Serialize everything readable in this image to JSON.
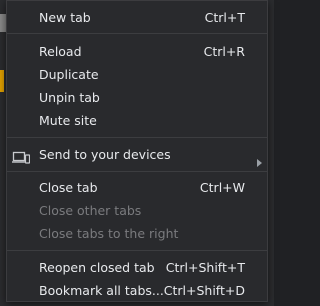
{
  "menu": {
    "items": {
      "new_tab": {
        "label": "New tab",
        "shortcut": "Ctrl+T"
      },
      "reload": {
        "label": "Reload",
        "shortcut": "Ctrl+R"
      },
      "duplicate": {
        "label": "Duplicate"
      },
      "unpin_tab": {
        "label": "Unpin tab"
      },
      "mute_site": {
        "label": "Mute site"
      },
      "send_to_devices": {
        "label": "Send to your devices",
        "icon": "devices-icon",
        "submenu_icon": "chevron-right-icon"
      },
      "close_tab": {
        "label": "Close tab",
        "shortcut": "Ctrl+W"
      },
      "close_other_tabs": {
        "label": "Close other tabs",
        "disabled": true
      },
      "close_tabs_right": {
        "label": "Close tabs to the right",
        "disabled": true
      },
      "reopen_closed_tab": {
        "label": "Reopen closed tab",
        "shortcut": "Ctrl+Shift+T"
      },
      "bookmark_all_tabs": {
        "label": "Bookmark all tabs...",
        "shortcut": "Ctrl+Shift+D"
      }
    }
  },
  "colors": {
    "menu_background": "#292a2d",
    "text": "#e8eaed",
    "disabled_text": "#7a7b7e",
    "separator": "#3c3d40"
  }
}
